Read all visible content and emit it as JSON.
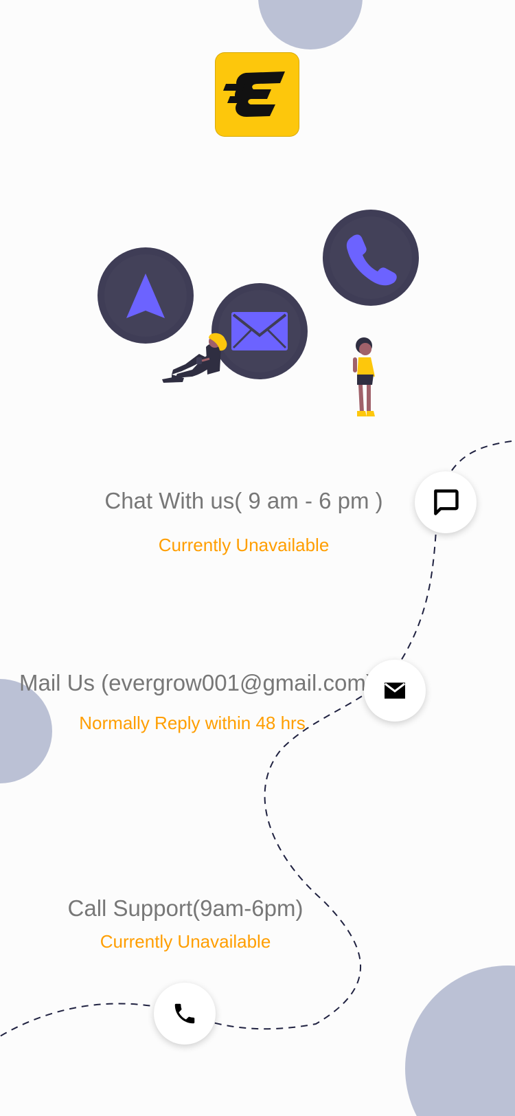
{
  "brand": {
    "logo_icon": "evergrow-logo-icon",
    "logo_color": "#fdc70c"
  },
  "hero": {
    "icons": [
      "navigation-icon",
      "mail-icon",
      "phone-icon"
    ],
    "accent_color": "#6c63ff",
    "bubble_color": "#3f3d56"
  },
  "contacts": {
    "chat": {
      "label": "Chat With us( 9 am - 6 pm )",
      "status": "Currently Unavailable",
      "icon": "chat-icon"
    },
    "mail": {
      "label": "Mail Us (evergrow001@gmail.com)",
      "status": "Normally Reply within 48 hrs",
      "icon": "mail-icon"
    },
    "call": {
      "label": "Call Support(9am-6pm)",
      "status": "Currently Unavailable",
      "icon": "phone-icon"
    }
  },
  "colors": {
    "label_text": "#777777",
    "status_text": "#ff9e00",
    "decor_blob": "#bbc1d5",
    "path_line": "#1f2140"
  }
}
